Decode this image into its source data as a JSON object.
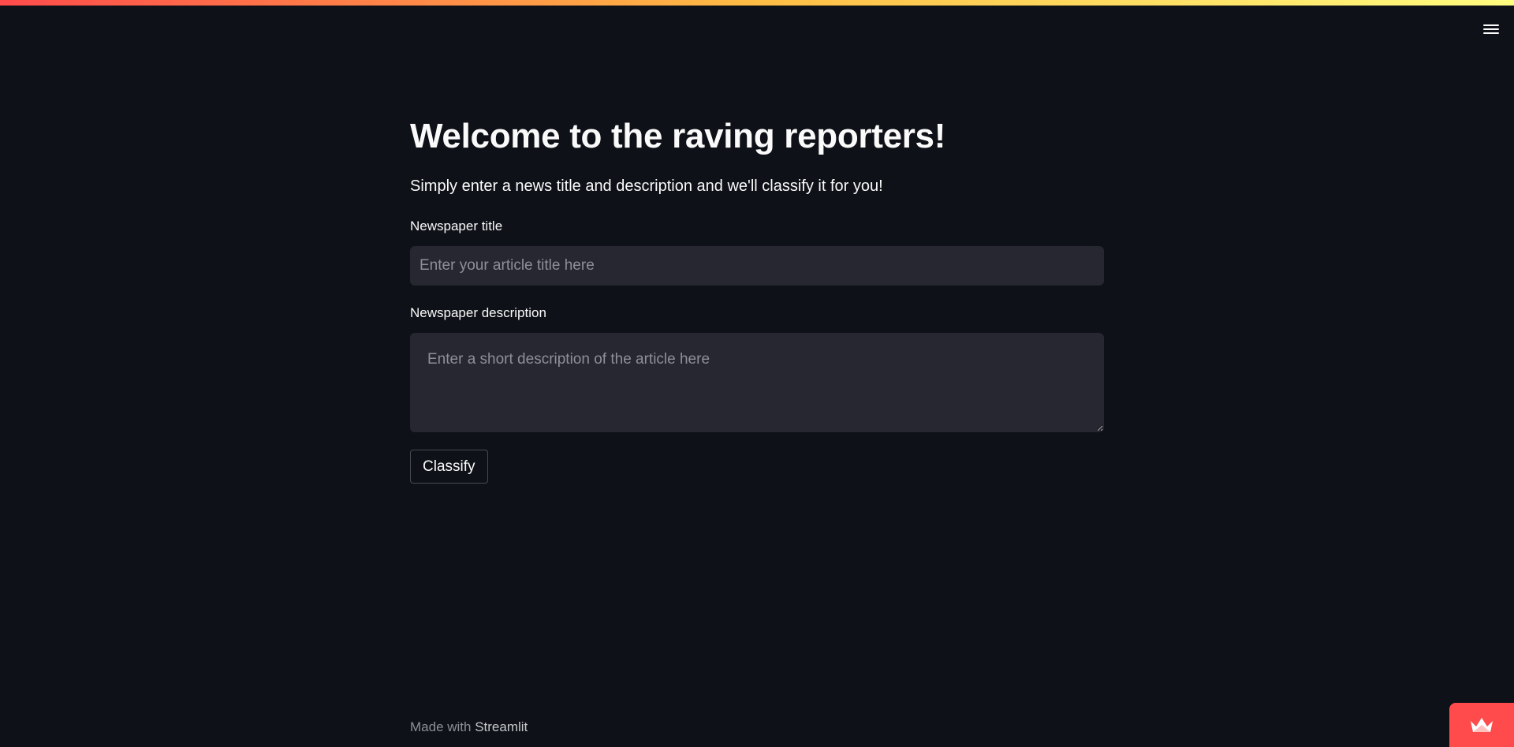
{
  "page": {
    "title": "Welcome to the raving reporters!",
    "intro": "Simply enter a news title and description and we'll classify it for you!"
  },
  "form": {
    "title_label": "Newspaper title",
    "title_placeholder": "Enter your article title here",
    "title_value": "",
    "description_label": "Newspaper description",
    "description_placeholder": "Enter a short description of the article here",
    "description_value": "",
    "submit_label": "Classify"
  },
  "footer": {
    "prefix": "Made with",
    "link_text": "Streamlit"
  },
  "icons": {
    "menu": "hamburger-menu-icon",
    "badge": "streamlit-crown-icon"
  },
  "colors": {
    "background": "#0e1117",
    "input_background": "#262730",
    "text": "#fafafa",
    "placeholder": "#8d8f99",
    "accent": "#ff4b4b",
    "decoration_gradient": [
      "#ff4b4b",
      "#ffbd45",
      "#fffd80"
    ]
  }
}
